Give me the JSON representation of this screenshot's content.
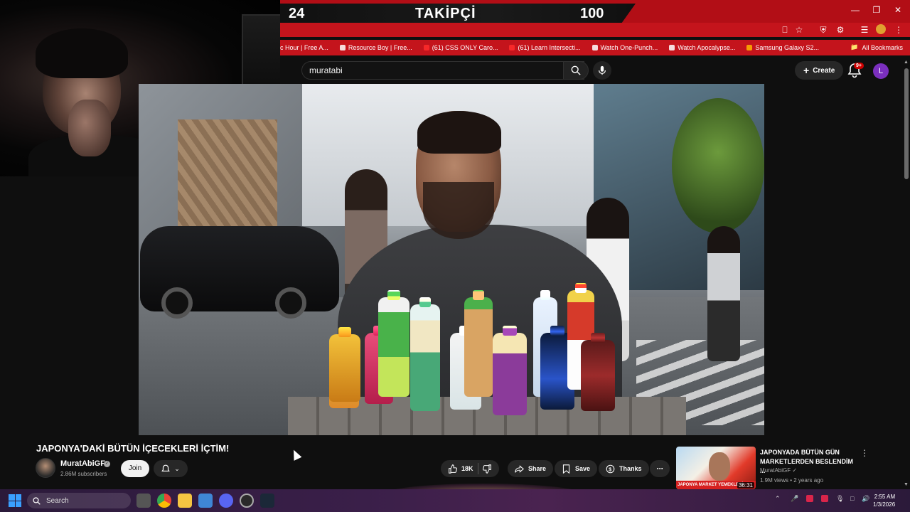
{
  "follow_goal": {
    "current": "24",
    "label": "TAKİPÇİ",
    "target": "100"
  },
  "browser": {
    "bookmarks": [
      "c Hour | Free A...",
      "Resource Boy | Free...",
      "(61) CSS ONLY Caro...",
      "(61) Learn Intersecti...",
      "Watch One-Punch...",
      "Watch Apocalypse...",
      "Samsung Galaxy S2..."
    ],
    "all_bookmarks": "All Bookmarks",
    "accent": "#c4141c"
  },
  "header": {
    "search_value": "muratabi",
    "create_label": "Create",
    "notif_count": "9+",
    "avatar_letter": "L"
  },
  "video": {
    "title": "JAPONYA'DAKİ BÜTÜN İÇECEKLERİ İÇTİM!",
    "channel": "MuratAbiGF",
    "subscribers": "2.86M subscribers",
    "join_label": "Join",
    "likes": "18K",
    "share_label": "Share",
    "save_label": "Save",
    "thanks_label": "Thanks"
  },
  "recommendation": {
    "title": "JAPONYADA BÜTÜN GÜN MARKETLERDEN BESLENDİM ...",
    "channel": "MuratAbiGF",
    "meta": "1.9M views • 2 years ago",
    "duration": "36:31",
    "thumb_banner": "JAPONYA MARKET YEMEKLERİ"
  },
  "taskbar": {
    "search_placeholder": "Search",
    "time": "2:55 AM",
    "date": "1/3/2026"
  }
}
